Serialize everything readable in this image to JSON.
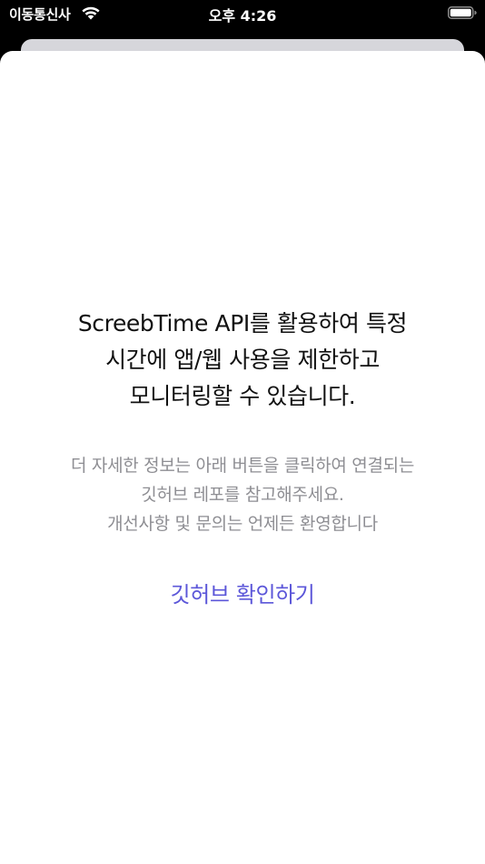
{
  "status_bar": {
    "carrier": "이동통신사",
    "time": "오후 4:26",
    "icons": [
      "wifi-icon",
      "battery-icon"
    ]
  },
  "sheet": {
    "headline_lines": [
      "ScreebTime API를 활용하여 특정",
      "시간에 앱/웹 사용을 제한하고",
      "모니터링할 수 있습니다."
    ],
    "description_lines": [
      "더 자세한 정보는 아래 버튼을 클릭하여 연결되는",
      "깃허브 레포를 참고해주세요.",
      "개선사항 및 문의는 언제든 환영합니다"
    ],
    "github_button_label": "깃허브 확인하기"
  },
  "colors": {
    "link": "#5c57d9",
    "secondary_text": "#8e8e93",
    "primary_text": "#111111"
  }
}
